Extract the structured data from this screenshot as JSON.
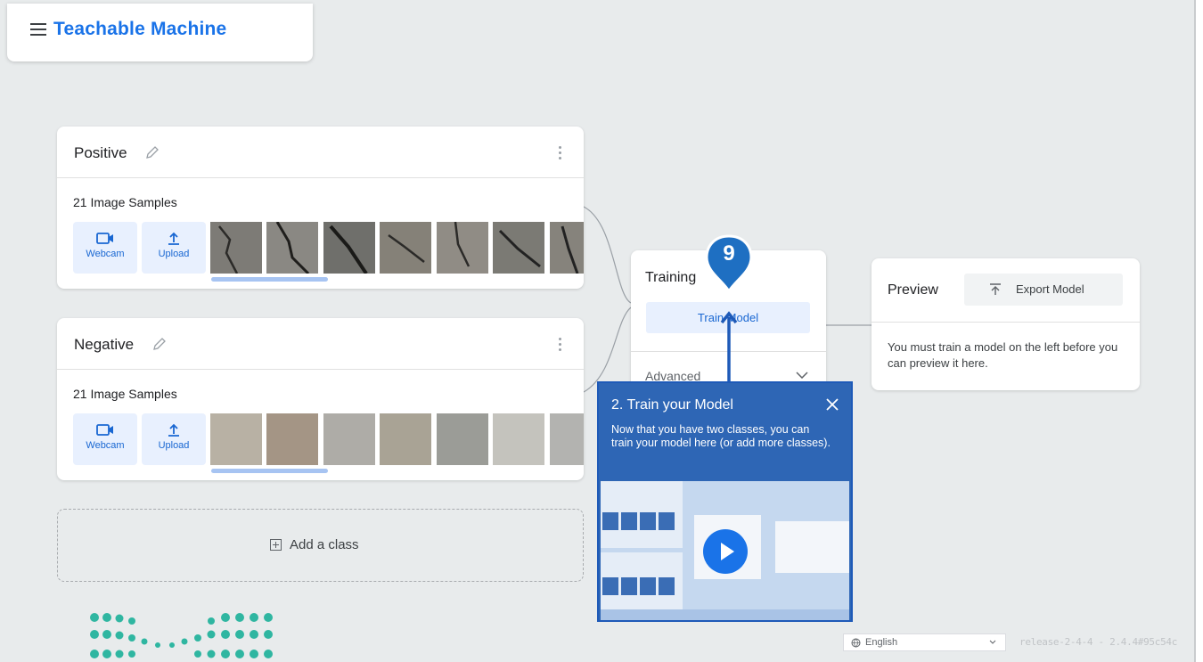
{
  "header": {
    "title": "Teachable Machine",
    "menu_icon": "hamburger-menu-icon"
  },
  "classes": [
    {
      "name": "Positive",
      "sample_count": "21 Image Samples",
      "webcam_label": "Webcam",
      "upload_label": "Upload",
      "thumb_colors": [
        "#7d7b76",
        "#8a8883",
        "#6f6f6b",
        "#858178",
        "#908c85",
        "#7b7a74",
        "#86837c"
      ]
    },
    {
      "name": "Negative",
      "sample_count": "21 Image Samples",
      "webcam_label": "Webcam",
      "upload_label": "Upload",
      "thumb_colors": [
        "#b8b1a4",
        "#a49585",
        "#aeaca7",
        "#a9a395",
        "#9b9c97",
        "#c4c3bd",
        "#b3b3b0"
      ]
    }
  ],
  "add_class": {
    "label": "Add a class"
  },
  "training": {
    "title": "Training",
    "button": "Train Model",
    "advanced": "Advanced"
  },
  "step_badge": {
    "number": "9",
    "color": "#1e6fc2"
  },
  "preview": {
    "title": "Preview",
    "export_button": "Export Model",
    "message": "You must train a model on the left before you can preview it here."
  },
  "tutorial": {
    "title": "2. Train your Model",
    "body": "Now that you have two classes, you can train your model here (or add more classes).",
    "play_icon": "play-icon"
  },
  "footer": {
    "language": "English",
    "release": "release-2-4-4 - 2.4.4#95c54c"
  },
  "colors": {
    "accent": "#1a73e8",
    "canvas": "#e8ebec",
    "tutorial_bg": "#2e66b5"
  }
}
